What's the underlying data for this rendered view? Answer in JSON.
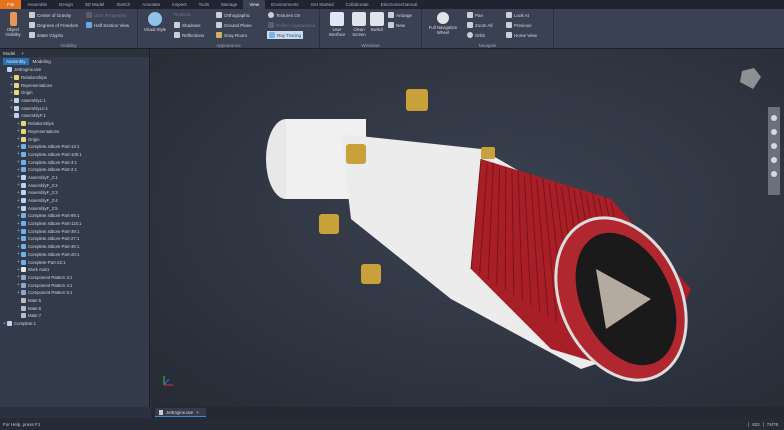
{
  "tabs": [
    "File",
    "Assemble",
    "Design",
    "3D Model",
    "Sketch",
    "Annotate",
    "Inspect",
    "Tools",
    "Manage",
    "View",
    "Environments",
    "Get Started",
    "Collaborate",
    "Electromechanical"
  ],
  "active_tab": "View",
  "ribbon": {
    "visibility": {
      "label": "Visibility",
      "object_visibility": "Object Visibility",
      "center_of_gravity": "Center of Gravity",
      "degrees_of_freedom": "Degrees of Freedom",
      "imate_glyphs": "iMate Glyphs",
      "user_iproperties": "User iProperties",
      "half_section": "Half Section View"
    },
    "appearance": {
      "label": "Appearance",
      "visual_style": "Visual Style",
      "realistic": "Realistic",
      "shadows": "Shadows",
      "reflections": "Reflections",
      "orthographic": "Orthographic",
      "ground_plane": "Ground Plane",
      "gray_room": "Gray Room",
      "textures_on": "Textures On",
      "reflect_appearance": "Reflect Appearance",
      "ray_tracing": "Ray Tracing"
    },
    "windows": {
      "label": "Windows",
      "user_interface": "User Interface",
      "clean_screen": "Clean Screen",
      "switch": "Switch",
      "arrange": "Arrange",
      "new": "New"
    },
    "navigate": {
      "label": "Navigate",
      "full_nav_wheel": "Full Navigation Wheel",
      "pan": "Pan",
      "zoom_all": "Zoom All",
      "orbit": "Orbit",
      "look_at": "Look At",
      "previous": "Previous",
      "home_view": "Home View"
    }
  },
  "browser": {
    "title": "Model",
    "add": "+",
    "subtabs": [
      "Assembly",
      "Modeling"
    ],
    "nodes": [
      {
        "label": "JetEngine.iam",
        "level": 0,
        "pm": "",
        "icon": "assembly"
      },
      {
        "label": "Relationships",
        "level": 1,
        "pm": "+",
        "icon": "folder"
      },
      {
        "label": "Representations",
        "level": 1,
        "pm": "+",
        "icon": "folder"
      },
      {
        "label": "Origin",
        "level": 1,
        "pm": "+",
        "icon": "folder"
      },
      {
        "label": "Assembly1:1",
        "level": 1,
        "pm": "+",
        "icon": "assembly"
      },
      {
        "label": "AssemblyLn:1",
        "level": 1,
        "pm": "+",
        "icon": "assembly"
      },
      {
        "label": "AssemblyF:1",
        "level": 1,
        "pm": "−",
        "icon": "assembly"
      },
      {
        "label": "Relationships",
        "level": 2,
        "pm": "+",
        "icon": "folder"
      },
      {
        "label": "Representations",
        "level": 2,
        "pm": "+",
        "icon": "folder"
      },
      {
        "label": "Origin",
        "level": 2,
        "pm": "+",
        "icon": "folder"
      },
      {
        "label": "Complete.stibom-Part-13:1",
        "level": 2,
        "pm": "+",
        "icon": "part"
      },
      {
        "label": "Complete.stibom-Part-105:1",
        "level": 2,
        "pm": "+",
        "icon": "part"
      },
      {
        "label": "Complete.stibom-Part-3:1",
        "level": 2,
        "pm": "+",
        "icon": "part"
      },
      {
        "label": "Complete.stibom-Part-2:1",
        "level": 2,
        "pm": "+",
        "icon": "part"
      },
      {
        "label": "AssemblyF_2:1",
        "level": 2,
        "pm": "+",
        "icon": "assembly"
      },
      {
        "label": "AssemblyF_2:2",
        "level": 2,
        "pm": "+",
        "icon": "assembly"
      },
      {
        "label": "AssemblyF_2:3",
        "level": 2,
        "pm": "+",
        "icon": "assembly"
      },
      {
        "label": "AssemblyF_2:4",
        "level": 2,
        "pm": "+",
        "icon": "assembly"
      },
      {
        "label": "AssemblyF_2:5",
        "level": 2,
        "pm": "+",
        "icon": "assembly"
      },
      {
        "label": "Complete.stibom-Part-99:1",
        "level": 2,
        "pm": "+",
        "icon": "part"
      },
      {
        "label": "Complete.stibom-Part-115:1",
        "level": 2,
        "pm": "+",
        "icon": "part"
      },
      {
        "label": "Complete.stibom-Part-39:1",
        "level": 2,
        "pm": "+",
        "icon": "part"
      },
      {
        "label": "Complete.stibom-Part-27:1",
        "level": 2,
        "pm": "+",
        "icon": "part"
      },
      {
        "label": "Complete.stibom-Part-36:1",
        "level": 2,
        "pm": "+",
        "icon": "part"
      },
      {
        "label": "Complete.stibom-Part-20:1",
        "level": 2,
        "pm": "+",
        "icon": "part"
      },
      {
        "label": "Complete-Part-22:1",
        "level": 2,
        "pm": "+",
        "icon": "part"
      },
      {
        "label": "Work Axis1",
        "level": 2,
        "pm": "+",
        "icon": "workaxis"
      },
      {
        "label": "Component Pattern 3:1",
        "level": 2,
        "pm": "+",
        "icon": "pattern"
      },
      {
        "label": "Component Pattern 4:1",
        "level": 2,
        "pm": "+",
        "icon": "pattern"
      },
      {
        "label": "Component Pattern 5:1",
        "level": 2,
        "pm": "+",
        "icon": "pattern"
      },
      {
        "label": "Mate:5",
        "level": 2,
        "pm": "",
        "icon": "mate"
      },
      {
        "label": "Mate:6",
        "level": 2,
        "pm": "",
        "icon": "mate"
      },
      {
        "label": "Mate:7",
        "level": 2,
        "pm": "",
        "icon": "mate"
      },
      {
        "label": "Complete:1",
        "level": 0,
        "pm": "+",
        "icon": "assembly"
      }
    ]
  },
  "document_tab": "JetEngine.iam",
  "document_tab_close": "×",
  "status": {
    "help": "For Help, press F1",
    "count1": "622",
    "count2": "74/78"
  },
  "colors": {
    "file_tab": "#e8731c",
    "accent": "#2c6fb4",
    "body_red": "#b8262c",
    "brass": "#c9a13a"
  }
}
